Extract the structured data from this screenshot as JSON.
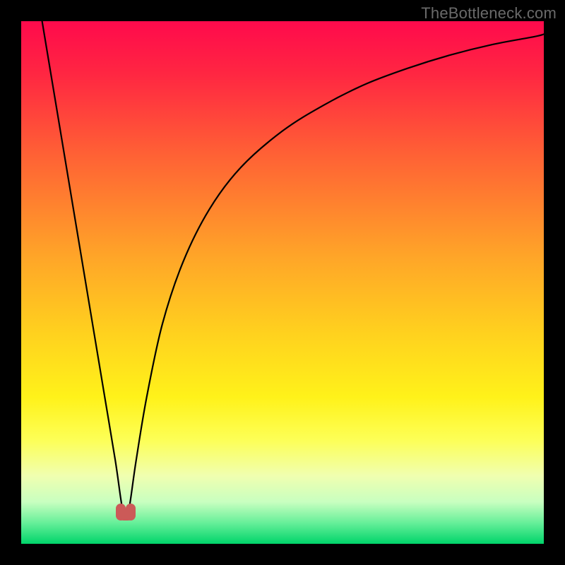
{
  "watermark": "TheBottleneck.com",
  "chart_data": {
    "type": "line",
    "title": "",
    "xlabel": "",
    "ylabel": "",
    "xlim": [
      0,
      100
    ],
    "ylim": [
      0,
      100
    ],
    "grid": false,
    "legend": false,
    "gradient_stops": [
      {
        "pos": 0.0,
        "color": "#ff0a4c"
      },
      {
        "pos": 0.1,
        "color": "#ff2642"
      },
      {
        "pos": 0.25,
        "color": "#ff5f35"
      },
      {
        "pos": 0.45,
        "color": "#ffa528"
      },
      {
        "pos": 0.6,
        "color": "#ffd21e"
      },
      {
        "pos": 0.72,
        "color": "#fff21a"
      },
      {
        "pos": 0.8,
        "color": "#fdff55"
      },
      {
        "pos": 0.87,
        "color": "#f0ffb0"
      },
      {
        "pos": 0.92,
        "color": "#c8ffc0"
      },
      {
        "pos": 0.96,
        "color": "#66ef99"
      },
      {
        "pos": 1.0,
        "color": "#00d46a"
      }
    ],
    "series": [
      {
        "name": "bottleneck-curve",
        "color": "#000000",
        "x": [
          4,
          6,
          8,
          10,
          12,
          14,
          16,
          18,
          19,
          19.5,
          20,
          20.5,
          21,
          22,
          24,
          27,
          31,
          36,
          42,
          50,
          58,
          66,
          74,
          82,
          90,
          98,
          100
        ],
        "y": [
          100,
          88,
          76,
          64,
          52,
          40,
          28,
          16,
          9,
          6,
          5,
          6,
          9,
          16,
          28,
          42,
          54,
          64,
          72,
          79,
          84,
          88,
          91,
          93.5,
          95.5,
          97,
          97.5
        ]
      }
    ],
    "marker": {
      "x": 20,
      "y": 5,
      "color": "#cb5a58"
    }
  }
}
